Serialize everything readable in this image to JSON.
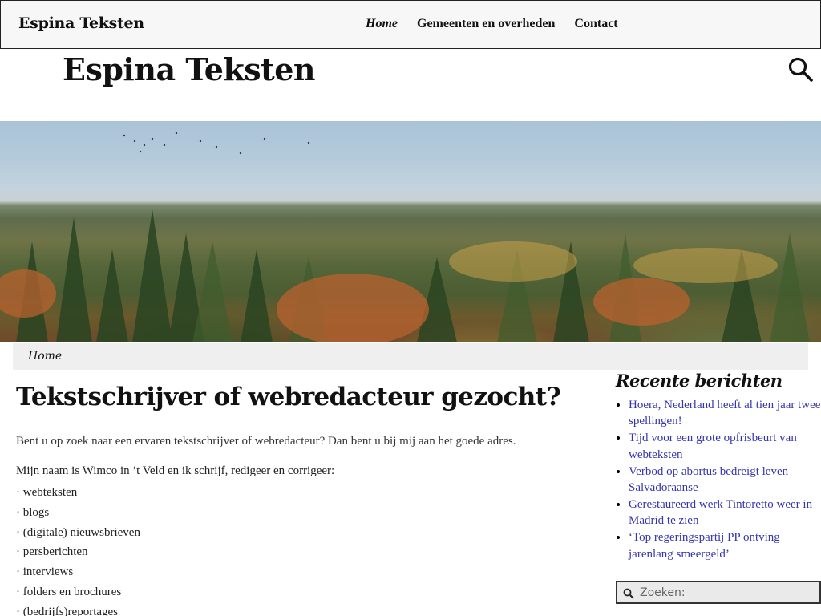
{
  "topbar": {
    "brand": "Espina Teksten",
    "nav": [
      {
        "label": "Home"
      },
      {
        "label": "Gemeenten en overheden"
      },
      {
        "label": "Contact"
      }
    ]
  },
  "header": {
    "site_title": "Espina Teksten"
  },
  "breadcrumb": {
    "current": "Home"
  },
  "main": {
    "title": "Tekstschrijver of webredacteur gezocht?",
    "intro": "Bent u op zoek naar een ervaren tekstschrijver of webredacteur? Dan bent u bij mij aan het goede adres.",
    "lead": "Mijn naam is Wimco in ’t Veld en ik schrijf, redigeer en corrigeer:",
    "services": [
      "· webteksten",
      "· blogs",
      "· (digitale) nieuwsbrieven",
      "· persberichten",
      "· interviews",
      "· folders en brochures",
      "· (bedrijfs)reportages"
    ]
  },
  "sidebar": {
    "heading": "Recente berichten",
    "posts": [
      "Hoera, Nederland heeft al tien jaar twee spellingen!",
      "Tijd voor een grote opfrisbeurt van webteksten",
      "Verbod op abortus bedreigt leven Salvadoraanse",
      "Gerestaureerd werk Tintoretto weer in Madrid te zien",
      "‘Top regeringspartij PP ontving jarenlang smeergeld’"
    ],
    "search_placeholder": "Zoeken:"
  },
  "colors": {
    "link": "#3535b0",
    "topbar_bg": "#f7f7f7",
    "breadcrumb_bg": "#efefef"
  }
}
